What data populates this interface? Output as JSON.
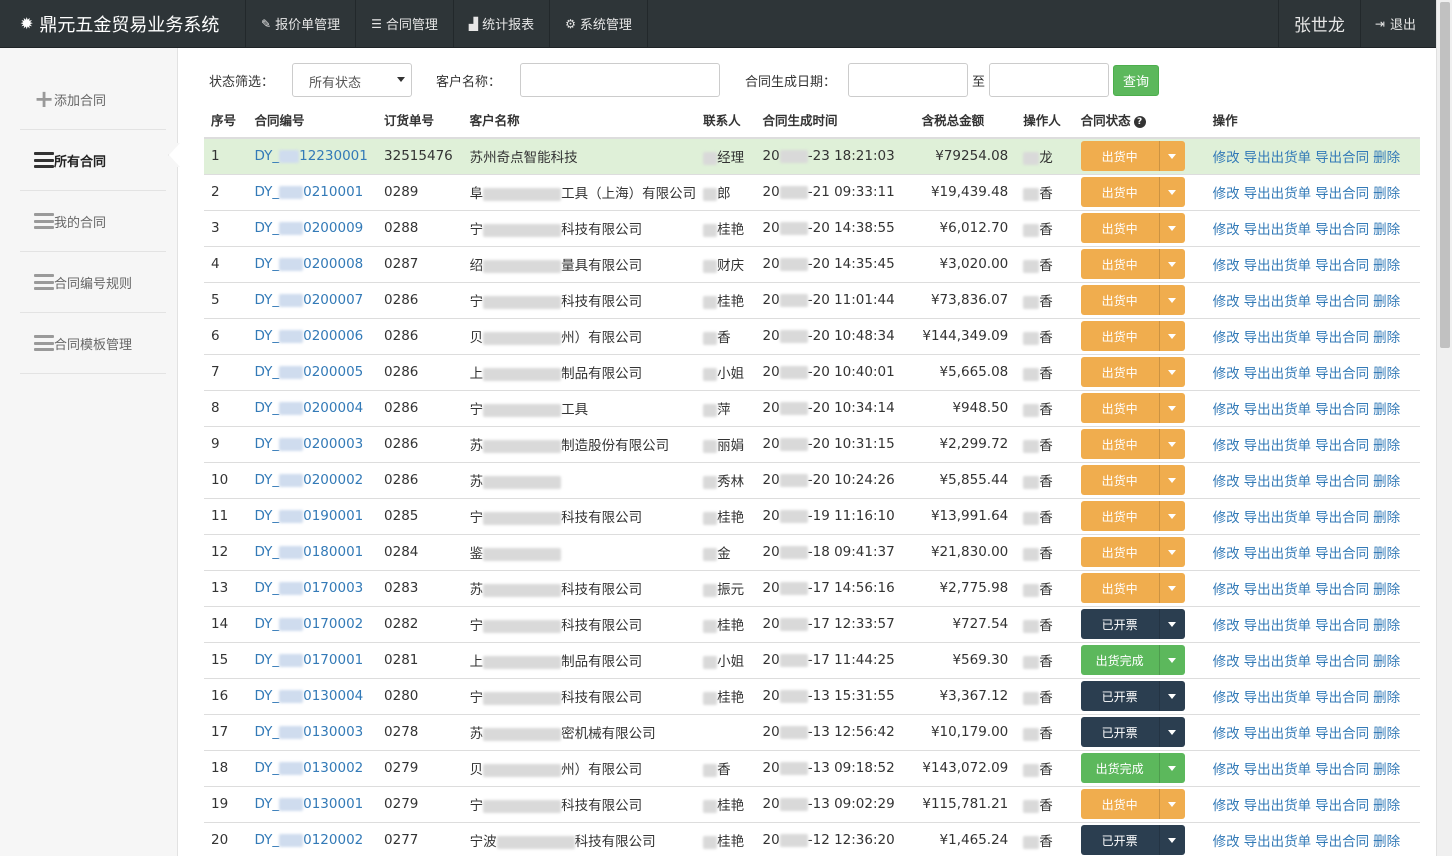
{
  "nav": {
    "brand": "鼎元五金贸易业务系统",
    "items": [
      {
        "label": "报价单管理",
        "icon": "edit-icon"
      },
      {
        "label": "合同管理",
        "icon": "list-icon"
      },
      {
        "label": "统计报表",
        "icon": "chart-icon"
      },
      {
        "label": "系统管理",
        "icon": "gear-icon"
      }
    ],
    "user": "张世龙",
    "logout": "退出"
  },
  "sidebar": {
    "items": [
      {
        "label": "添加合同",
        "icon": "plus-icon"
      },
      {
        "label": "所有合同",
        "icon": "menu-icon",
        "active": true
      },
      {
        "label": "我的合同",
        "icon": "menu-icon"
      },
      {
        "label": "合同编号规则",
        "icon": "menu-icon"
      },
      {
        "label": "合同模板管理",
        "icon": "menu-icon"
      }
    ]
  },
  "filters": {
    "status_label": "状态筛选：",
    "status_value": "所有状态",
    "customer_label": "客户名称：",
    "customer_value": "",
    "date_label": "合同生成日期：",
    "date_from": "",
    "date_to_label": "至",
    "date_to": "",
    "query_button": "查询"
  },
  "table": {
    "headers": [
      "序号",
      "合同编号",
      "订货单号",
      "客户名称",
      "联系人",
      "合同生成时间",
      "含税总金额",
      "操作人",
      "合同状态",
      "操作"
    ],
    "actions": [
      "修改",
      "导出出货单",
      "导出合同",
      "删除"
    ],
    "status_colors": {
      "出货中": "#f0ad4e",
      "出货完成": "#5cb85c",
      "已开票": "#2b3e50"
    },
    "rows": [
      {
        "no": "1",
        "code_a": "DY_",
        "code_b": "12230001",
        "order": "32515476",
        "cust_a": "苏州奇点智能科技",
        "cust_b": "",
        "contact_a": "",
        "contact_b": "经理",
        "time_a": "20",
        "time_b": "-23 18:21:03",
        "amount": "¥79254.08",
        "op_a": "",
        "op_b": "龙",
        "status": "出货中"
      },
      {
        "no": "2",
        "code_a": "DY_",
        "code_b": "0210001",
        "order": "0289",
        "cust_a": "阜",
        "cust_b": "工具（上海）有限公司",
        "contact_a": "",
        "contact_b": "郎",
        "time_a": "20",
        "time_b": "-21 09:33:11",
        "amount": "¥19,439.48",
        "op_a": "",
        "op_b": "香",
        "status": "出货中"
      },
      {
        "no": "3",
        "code_a": "DY_",
        "code_b": "0200009",
        "order": "0288",
        "cust_a": "宁",
        "cust_b": "科技有限公司",
        "contact_a": "",
        "contact_b": "桂艳",
        "time_a": "20",
        "time_b": "-20 14:38:55",
        "amount": "¥6,012.70",
        "op_a": "",
        "op_b": "香",
        "status": "出货中"
      },
      {
        "no": "4",
        "code_a": "DY_",
        "code_b": "0200008",
        "order": "0287",
        "cust_a": "绍",
        "cust_b": "量具有限公司",
        "contact_a": "",
        "contact_b": "财庆",
        "time_a": "20",
        "time_b": "-20 14:35:45",
        "amount": "¥3,020.00",
        "op_a": "",
        "op_b": "香",
        "status": "出货中"
      },
      {
        "no": "5",
        "code_a": "DY_",
        "code_b": "0200007",
        "order": "0286",
        "cust_a": "宁",
        "cust_b": "科技有限公司",
        "contact_a": "",
        "contact_b": "桂艳",
        "time_a": "20",
        "time_b": "-20 11:01:44",
        "amount": "¥73,836.07",
        "op_a": "",
        "op_b": "香",
        "status": "出货中"
      },
      {
        "no": "6",
        "code_a": "DY_",
        "code_b": "0200006",
        "order": "0286",
        "cust_a": "贝",
        "cust_b": "州）有限公司",
        "contact_a": "",
        "contact_b": "香",
        "time_a": "20",
        "time_b": "-20 10:48:34",
        "amount": "¥144,349.09",
        "op_a": "",
        "op_b": "香",
        "status": "出货中"
      },
      {
        "no": "7",
        "code_a": "DY_",
        "code_b": "0200005",
        "order": "0286",
        "cust_a": "上",
        "cust_b": "制品有限公司",
        "contact_a": "",
        "contact_b": "小姐",
        "time_a": "20",
        "time_b": "-20 10:40:01",
        "amount": "¥5,665.08",
        "op_a": "",
        "op_b": "香",
        "status": "出货中"
      },
      {
        "no": "8",
        "code_a": "DY_",
        "code_b": "0200004",
        "order": "0286",
        "cust_a": "宁",
        "cust_b": "工具",
        "contact_a": "",
        "contact_b": "萍",
        "time_a": "20",
        "time_b": "-20 10:34:14",
        "amount": "¥948.50",
        "op_a": "",
        "op_b": "香",
        "status": "出货中"
      },
      {
        "no": "9",
        "code_a": "DY_",
        "code_b": "0200003",
        "order": "0286",
        "cust_a": "苏",
        "cust_b": "制造股份有限公司",
        "contact_a": "",
        "contact_b": "丽娟",
        "time_a": "20",
        "time_b": "-20 10:31:15",
        "amount": "¥2,299.72",
        "op_a": "",
        "op_b": "香",
        "status": "出货中"
      },
      {
        "no": "10",
        "code_a": "DY_",
        "code_b": "0200002",
        "order": "0286",
        "cust_a": "苏",
        "cust_b": "",
        "contact_a": "",
        "contact_b": "秀林",
        "time_a": "20",
        "time_b": "-20 10:24:26",
        "amount": "¥5,855.44",
        "op_a": "",
        "op_b": "香",
        "status": "出货中"
      },
      {
        "no": "11",
        "code_a": "DY_",
        "code_b": "0190001",
        "order": "0285",
        "cust_a": "宁",
        "cust_b": "科技有限公司",
        "contact_a": "",
        "contact_b": "桂艳",
        "time_a": "20",
        "time_b": "-19 11:16:10",
        "amount": "¥13,991.64",
        "op_a": "",
        "op_b": "香",
        "status": "出货中"
      },
      {
        "no": "12",
        "code_a": "DY_",
        "code_b": "0180001",
        "order": "0284",
        "cust_a": "鉴",
        "cust_b": "",
        "contact_a": "",
        "contact_b": "金",
        "time_a": "20",
        "time_b": "-18 09:41:37",
        "amount": "¥21,830.00",
        "op_a": "",
        "op_b": "香",
        "status": "出货中"
      },
      {
        "no": "13",
        "code_a": "DY_",
        "code_b": "0170003",
        "order": "0283",
        "cust_a": "苏",
        "cust_b": "科技有限公司",
        "contact_a": "",
        "contact_b": "振元",
        "time_a": "20",
        "time_b": "-17 14:56:16",
        "amount": "¥2,775.98",
        "op_a": "",
        "op_b": "香",
        "status": "出货中"
      },
      {
        "no": "14",
        "code_a": "DY_",
        "code_b": "0170002",
        "order": "0282",
        "cust_a": "宁",
        "cust_b": "科技有限公司",
        "contact_a": "",
        "contact_b": "桂艳",
        "time_a": "20",
        "time_b": "-17 12:33:57",
        "amount": "¥727.54",
        "op_a": "",
        "op_b": "香",
        "status": "已开票"
      },
      {
        "no": "15",
        "code_a": "DY_",
        "code_b": "0170001",
        "order": "0281",
        "cust_a": "上",
        "cust_b": "制品有限公司",
        "contact_a": "",
        "contact_b": "小姐",
        "time_a": "20",
        "time_b": "-17 11:44:25",
        "amount": "¥569.30",
        "op_a": "",
        "op_b": "香",
        "status": "出货完成"
      },
      {
        "no": "16",
        "code_a": "DY_",
        "code_b": "0130004",
        "order": "0280",
        "cust_a": "宁",
        "cust_b": "科技有限公司",
        "contact_a": "",
        "contact_b": "桂艳",
        "time_a": "20",
        "time_b": "-13 15:31:55",
        "amount": "¥3,367.12",
        "op_a": "",
        "op_b": "香",
        "status": "已开票"
      },
      {
        "no": "17",
        "code_a": "DY_",
        "code_b": "0130003",
        "order": "0278",
        "cust_a": "苏",
        "cust_b": "密机械有限公司",
        "contact_a": "",
        "contact_b": "",
        "time_a": "20",
        "time_b": "-13 12:56:42",
        "amount": "¥10,179.00",
        "op_a": "",
        "op_b": "香",
        "status": "已开票"
      },
      {
        "no": "18",
        "code_a": "DY_",
        "code_b": "0130002",
        "order": "0279",
        "cust_a": "贝",
        "cust_b": "州）有限公司",
        "contact_a": "",
        "contact_b": "香",
        "time_a": "20",
        "time_b": "-13 09:18:52",
        "amount": "¥143,072.09",
        "op_a": "",
        "op_b": "香",
        "status": "出货完成"
      },
      {
        "no": "19",
        "code_a": "DY_",
        "code_b": "0130001",
        "order": "0279",
        "cust_a": "宁",
        "cust_b": "科技有限公司",
        "contact_a": "",
        "contact_b": "桂艳",
        "time_a": "20",
        "time_b": "-13 09:02:29",
        "amount": "¥115,781.21",
        "op_a": "",
        "op_b": "香",
        "status": "出货中"
      },
      {
        "no": "20",
        "code_a": "DY_",
        "code_b": "0120002",
        "order": "0277",
        "cust_a": "宁波",
        "cust_b": "科技有限公司",
        "contact_a": "",
        "contact_b": "桂艳",
        "time_a": "20",
        "time_b": "-12 12:36:20",
        "amount": "¥1,465.24",
        "op_a": "",
        "op_b": "香",
        "status": "已开票"
      }
    ]
  }
}
